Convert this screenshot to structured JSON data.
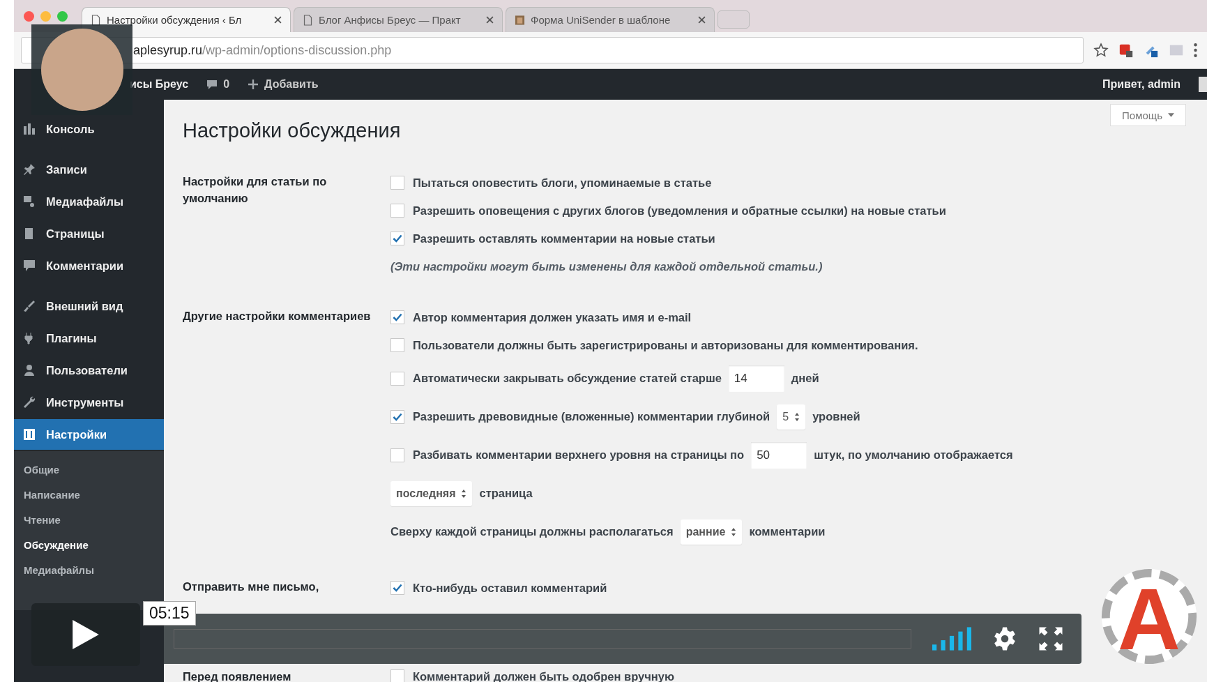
{
  "browser": {
    "tabs": [
      {
        "title": "Настройки обсуждения ‹ Бл",
        "selected": true
      },
      {
        "title": "Блог Анфисы Бреус — Практ",
        "selected": false
      },
      {
        "title": "Форма UniSender в шаблоне",
        "selected": false
      }
    ],
    "address": {
      "domain": "aplesyrup.ru",
      "path": "/wp-admin/options-discussion.php"
    }
  },
  "admin_bar": {
    "site": "исы Бреус",
    "comments": "0",
    "add": "Добавить",
    "greeting": "Привет, admin"
  },
  "sidebar": {
    "items": [
      {
        "label": "Консоль",
        "selected": false
      },
      {
        "label": "Записи",
        "selected": false
      },
      {
        "label": "Медиафайлы",
        "selected": false
      },
      {
        "label": "Страницы",
        "selected": false
      },
      {
        "label": "Комментарии",
        "selected": false
      },
      {
        "label": "Внешний вид",
        "selected": false
      },
      {
        "label": "Плагины",
        "selected": false
      },
      {
        "label": "Пользователи",
        "selected": false
      },
      {
        "label": "Инструменты",
        "selected": false
      },
      {
        "label": "Настройки",
        "selected": true
      }
    ],
    "submenu": [
      {
        "label": "Общие",
        "selected": false
      },
      {
        "label": "Написание",
        "selected": false
      },
      {
        "label": "Чтение",
        "selected": false
      },
      {
        "label": "Обсуждение",
        "selected": true
      },
      {
        "label": "Медиафайлы",
        "selected": false
      }
    ]
  },
  "page": {
    "title": "Настройки обсуждения",
    "help": "Помощь",
    "sections": [
      {
        "label": "Настройки для статьи по умолчанию",
        "items": [
          {
            "kind": "checkbox",
            "checked": false,
            "text": "Пытаться оповестить блоги, упоминаемые в статье"
          },
          {
            "kind": "checkbox",
            "checked": false,
            "text": "Разрешить оповещения с других блогов (уведомления и обратные ссылки) на новые статьи"
          },
          {
            "kind": "checkbox",
            "checked": true,
            "text": "Разрешить оставлять комментарии на новые статьи"
          },
          {
            "kind": "note",
            "text": "(Эти настройки могут быть изменены для каждой отдельной статьи.)"
          }
        ]
      },
      {
        "label": "Другие настройки комментариев",
        "items": [
          {
            "kind": "checkbox",
            "checked": true,
            "text": "Автор комментария должен указать имя и e-mail"
          },
          {
            "kind": "checkbox",
            "checked": false,
            "text": "Пользователи должны быть зарегистрированы и авторизованы для комментирования."
          },
          {
            "kind": "checkbox",
            "checked": false,
            "text": "Автоматически закрывать обсуждение статей старше",
            "field": "14",
            "suffix": "дней"
          },
          {
            "kind": "checkbox",
            "checked": true,
            "text": "Разрешить древовидные (вложенные) комментарии глубиной",
            "select": "5",
            "suffix": "уровней"
          },
          {
            "kind": "checkbox",
            "checked": false,
            "text": "Разбивать комментарии верхнего уровня на страницы по",
            "field": "50",
            "suffix": "штук, по умолчанию отображается"
          },
          {
            "kind": "select_line",
            "select": "последняя",
            "suffix": "страница"
          },
          {
            "kind": "text_select",
            "text": "Сверху каждой страницы должны располагаться",
            "select": "ранние",
            "suffix": "комментарии"
          }
        ]
      },
      {
        "label": "Отправить мне письмо,",
        "items": [
          {
            "kind": "checkbox",
            "checked": true,
            "text": "Кто-нибудь оставил комментарий"
          }
        ]
      },
      {
        "label": "Перед появлением",
        "items": [
          {
            "kind": "checkbox",
            "checked": false,
            "text": "Комментарий должен быть одобрен вручную"
          }
        ]
      }
    ]
  },
  "video": {
    "time": "05:15",
    "logo": {
      "letter": "A"
    }
  }
}
